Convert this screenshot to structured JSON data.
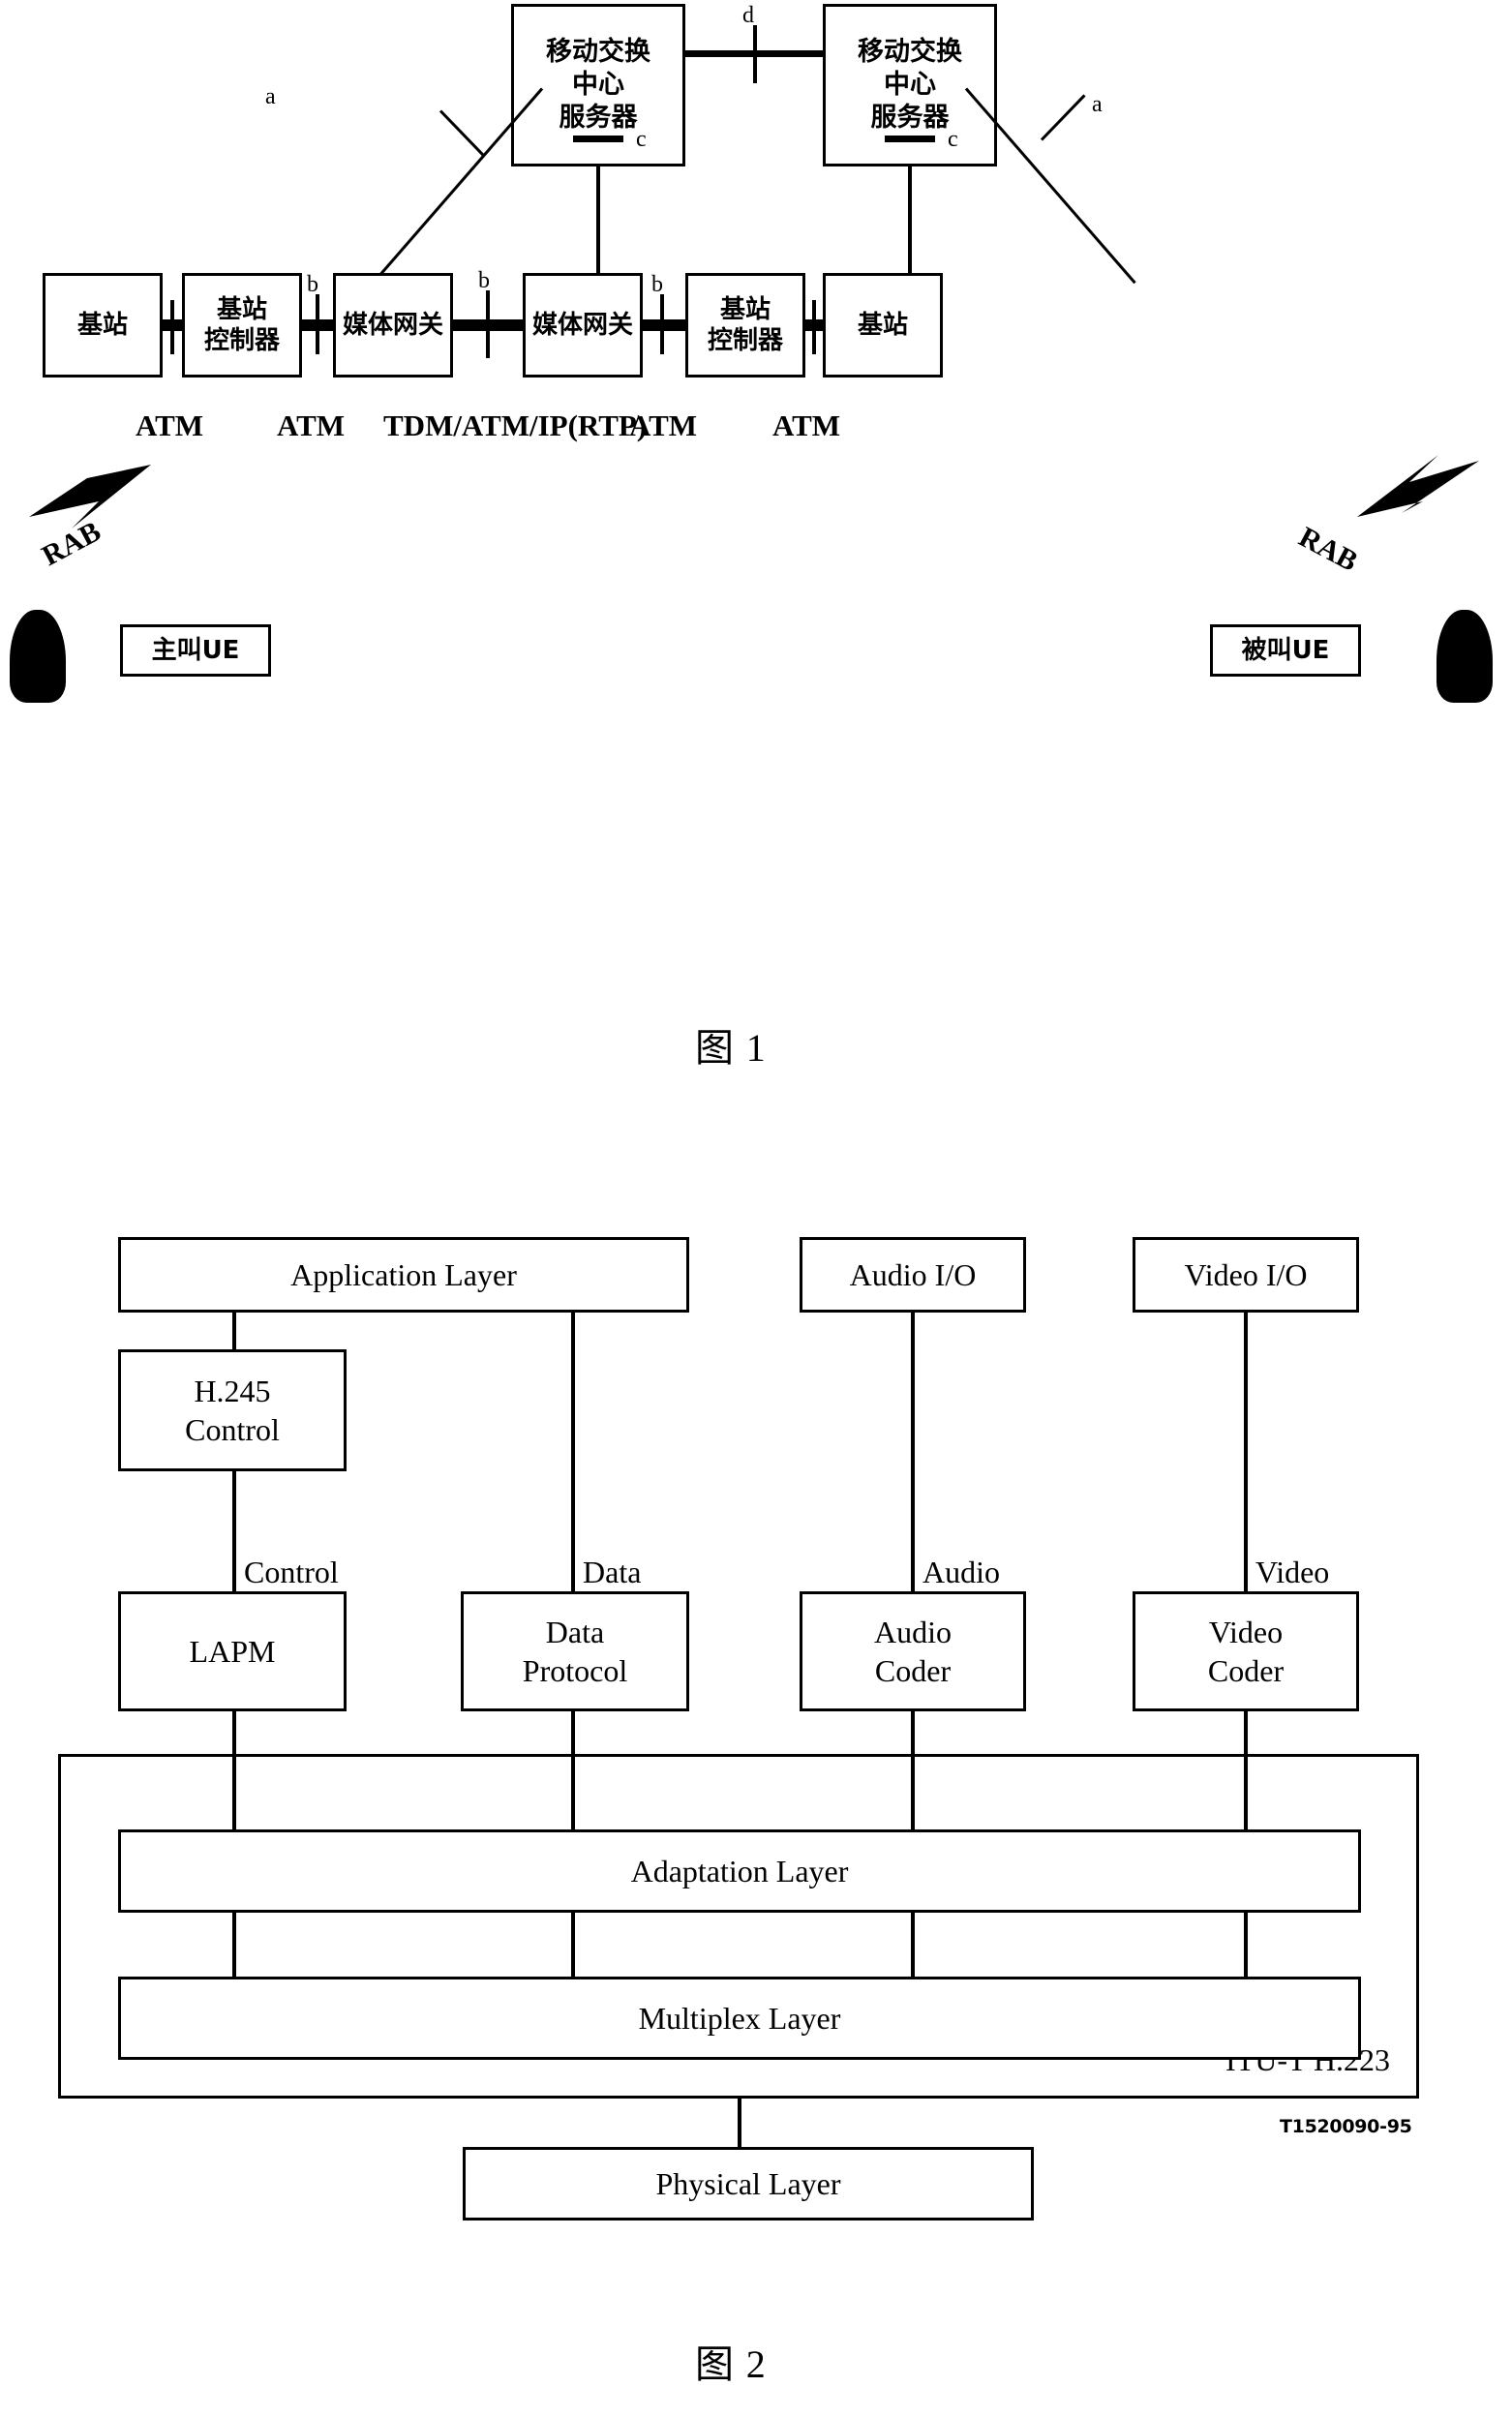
{
  "document": {
    "reference_code": "T1520090-95"
  },
  "figure1": {
    "caption_label": "图",
    "caption_number": "1",
    "msc_servers": [
      {
        "line1": "移动交换",
        "line2": "中心",
        "line3": "服务器"
      },
      {
        "line1": "移动交换",
        "line2": "中心",
        "line3": "服务器"
      }
    ],
    "nodes": [
      {
        "name": "基站"
      },
      {
        "name": "基站",
        "name2": "控制器"
      },
      {
        "name": "媒体网关"
      },
      {
        "name": "媒体网关"
      },
      {
        "name": "基站",
        "name2": "控制器"
      },
      {
        "name": "基站"
      }
    ],
    "interface_labels": {
      "a_left": "a",
      "a_right": "a",
      "b1": "b",
      "b2": "b",
      "b3": "b",
      "c_left": "c",
      "c_right": "c",
      "d": "d"
    },
    "bearer_labels": [
      "ATM",
      "ATM",
      "TDM/ATM/IP(RTP)",
      "ATM",
      "ATM"
    ],
    "radio_labels": {
      "left": "RAB",
      "right": "RAB"
    },
    "ue": {
      "calling": "主叫UE",
      "called": "被叫UE"
    }
  },
  "figure2": {
    "caption_label": "图",
    "caption_number": "2",
    "top_boxes": [
      {
        "label": "Application Layer"
      },
      {
        "label": "Audio I/O"
      },
      {
        "label": "Video I/O"
      }
    ],
    "control_box": {
      "line1": "H.245",
      "line2": "Control"
    },
    "channel_labels": [
      "Control",
      "Data",
      "Audio",
      "Video"
    ],
    "protocol_boxes": [
      {
        "line1": "LAPM",
        "line2": ""
      },
      {
        "line1": "Data",
        "line2": "Protocol"
      },
      {
        "line1": "Audio",
        "line2": "Coder"
      },
      {
        "line1": "Video",
        "line2": "Coder"
      }
    ],
    "stack_boxes": [
      {
        "label": "Adaptation Layer"
      },
      {
        "label": "Multiplex Layer"
      }
    ],
    "frame_label": "ITU-T H.223",
    "physical_box": {
      "label": "Physical Layer"
    }
  }
}
